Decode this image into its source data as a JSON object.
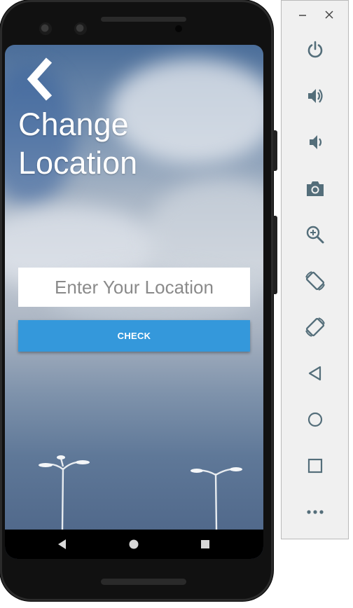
{
  "screen": {
    "title_line1": "Change",
    "title_line2": "Location",
    "location_placeholder": "Enter Your Location",
    "check_label": "CHECK"
  },
  "colors": {
    "button": "#3498db",
    "panel_icon": "#546e7a",
    "panel_bg": "#f0f0f0"
  },
  "emulator_panel": {
    "window_controls": [
      "minimize-icon",
      "close-icon"
    ],
    "tools": [
      "power-icon",
      "volume-up-icon",
      "volume-down-icon",
      "camera-icon",
      "zoom-icon",
      "rotate-left-icon",
      "rotate-right-icon",
      "back-icon",
      "home-icon",
      "overview-icon",
      "more-icon"
    ]
  },
  "android_nav": [
    "back-icon",
    "home-icon",
    "recents-icon"
  ]
}
